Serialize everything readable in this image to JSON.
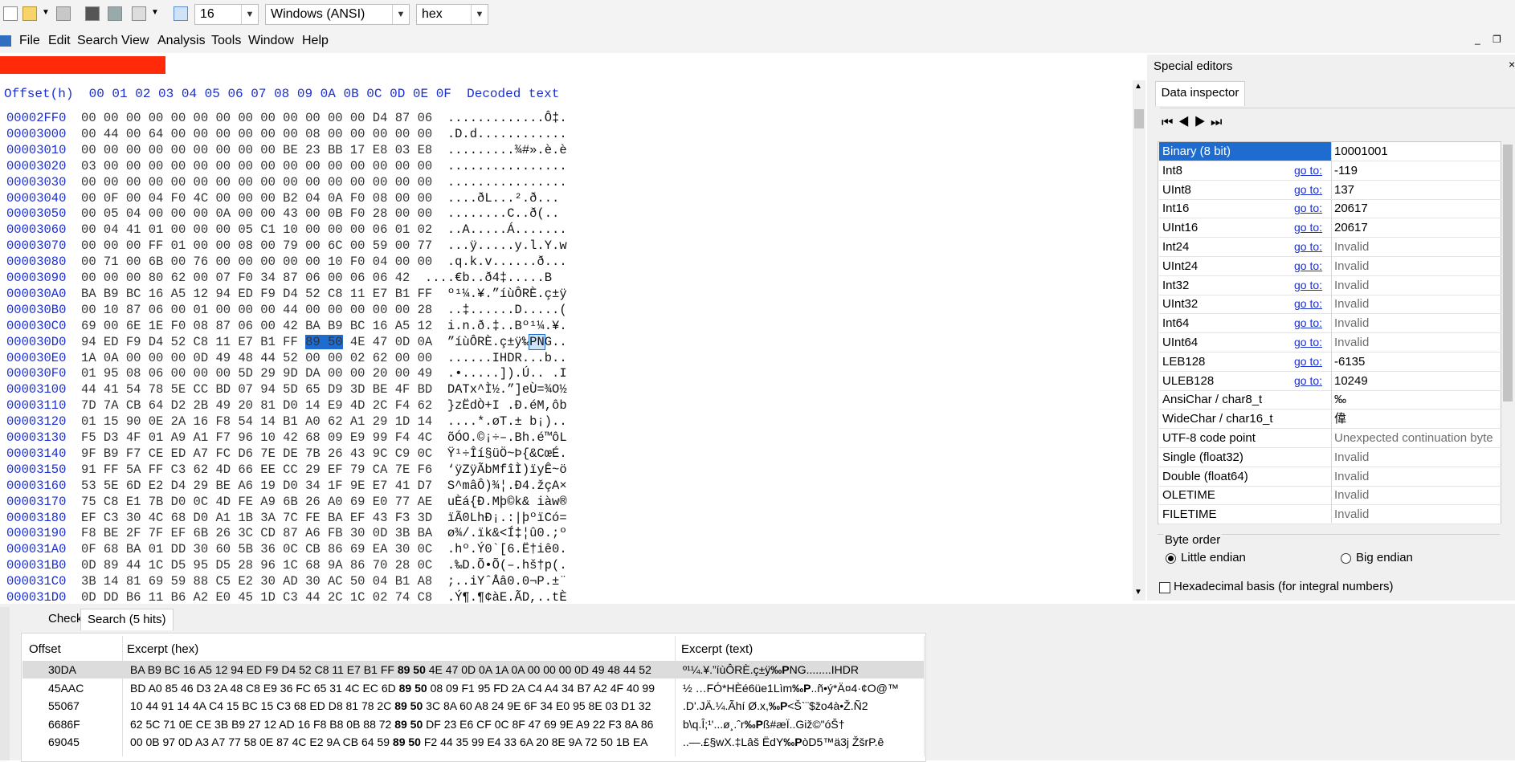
{
  "toolbar": {
    "bytes_per_row": "16",
    "encoding": "Windows (ANSI)",
    "number_format": "hex"
  },
  "menu": [
    "File",
    "Edit",
    "Search",
    "View",
    "Analysis",
    "Tools",
    "Window",
    "Help"
  ],
  "hex": {
    "offset_header": "Offset(h)",
    "columns": "00 01 02 03 04 05 06 07 08 09 0A 0B 0C 0D 0E 0F",
    "decoded_header": "Decoded text",
    "rows": [
      {
        "off": "00002FF0",
        "hex": "00 00 00 00 00 00 00 00 00 00 00 00 00 D4 87 06",
        "text": ".............Ô‡."
      },
      {
        "off": "00003000",
        "hex": "00 44 00 64 00 00 00 00 00 00 08 00 00 00 00 00",
        "text": ".D.d............"
      },
      {
        "off": "00003010",
        "hex": "00 00 00 00 00 00 00 00 00 BE 23 BB 17 E8 03 E8",
        "text": ".........¾#».è.è"
      },
      {
        "off": "00003020",
        "hex": "03 00 00 00 00 00 00 00 00 00 00 00 00 00 00 00",
        "text": "................"
      },
      {
        "off": "00003030",
        "hex": "00 00 00 00 00 00 00 00 00 00 00 00 00 00 00 00",
        "text": "................"
      },
      {
        "off": "00003040",
        "hex": "00 0F 00 04 F0 4C 00 00 00 B2 04 0A F0 08 00 00",
        "text": "....ðL...².ð..."
      },
      {
        "off": "00003050",
        "hex": "00 05 04 00 00 00 0A 00 00 43 00 0B F0 28 00 00",
        "text": "........C..ð(.."
      },
      {
        "off": "00003060",
        "hex": "00 04 41 01 00 00 00 05 C1 10 00 00 00 06 01 02",
        "text": "..A.....Á......."
      },
      {
        "off": "00003070",
        "hex": "00 00 00 FF 01 00 00 08 00 79 00 6C 00 59 00 77",
        "text": "...ÿ.....y.l.Y.w"
      },
      {
        "off": "00003080",
        "hex": "00 71 00 6B 00 76 00 00 00 00 00 10 F0 04 00 00",
        "text": ".q.k.v......ð..."
      },
      {
        "off": "00003090",
        "hex": "00 00 00 80 62 00 07 F0 34 87 06 00 06 06 42",
        "text": "....€b..ð4‡.....B"
      },
      {
        "off": "000030A0",
        "hex": "BA B9 BC 16 A5 12 94 ED F9 D4 52 C8 11 E7 B1 FF",
        "text": "º¹¼.¥.”íùÔRÈ.ç±ÿ"
      },
      {
        "off": "000030B0",
        "hex": "00 10 87 06 00 01 00 00 00 44 00 00 00 00 00 28",
        "text": "..‡......D.....("
      },
      {
        "off": "000030C0",
        "hex": "69 00 6E 1E F0 08 87 06 00 42 BA B9 BC 16 A5 12",
        "text": "i.n.ð.‡..Bº¹¼.¥."
      },
      {
        "off": "000030D0",
        "hex": "94 ED F9 D4 52 C8 11 E7 B1 FF 89 50 4E 47 0D 0A",
        "text": "”íùÔRÈ.ç±ÿ‰PNG.."
      },
      {
        "off": "000030E0",
        "hex": "1A 0A 00 00 00 0D 49 48 44 52 00 00 02 62 00 00",
        "text": "......IHDR...b.."
      },
      {
        "off": "000030F0",
        "hex": "01 95 08 06 00 00 00 5D 29 9D DA 00 00 20 00 49",
        "text": ".•.....]).Ú.. .I"
      },
      {
        "off": "00003100",
        "hex": "44 41 54 78 5E CC BD 07 94 5D 65 D9 3D BE 4F BD",
        "text": "DATx^Ì½.”]eÙ=¾O½"
      },
      {
        "off": "00003110",
        "hex": "7D 7A CB 64 D2 2B 49 20 81 D0 14 E9 4D 2C F4 62",
        "text": "}zËdÒ+I .Ð.éM,ôb"
      },
      {
        "off": "00003120",
        "hex": "01 15 90 0E 2A 16 F8 54 14 B1 A0 62 A1 29 1D 14",
        "text": "....*.øT.± b¡).."
      },
      {
        "off": "00003130",
        "hex": "F5 D3 4F 01 A9 A1 F7 96 10 42 68 09 E9 99 F4 4C",
        "text": "õÓO.©¡÷–.Bh.é™ôL"
      },
      {
        "off": "00003140",
        "hex": "9F B9 F7 CE ED A7 FC D6 7E DE 7B 26 43 9C C9 0C",
        "text": "Ÿ¹÷Îí§üÖ~Þ{&CœÉ."
      },
      {
        "off": "00003150",
        "hex": "91 FF 5A FF C3 62 4D 66 EE CC 29 EF 79 CA 7E F6",
        "text": "‘ÿZÿÃbMfîÌ)ïyÊ~ö"
      },
      {
        "off": "00003160",
        "hex": "53 5E 6D E2 D4 29 BE A6 19 D0 34 1F 9E E7 41 D7",
        "text": "S^mâÔ)¾¦.Ð4.žçA×"
      },
      {
        "off": "00003170",
        "hex": "75 C8 E1 7B D0 0C 4D FE A9 6B 26 A0 69 E0 77 AE",
        "text": "uÈá{Ð.Mþ©k& iàw®"
      },
      {
        "off": "00003180",
        "hex": "EF C3 30 4C 68 D0 A1 1B 3A 7C FE BA EF 43 F3 3D",
        "text": "ïÃ0LhÐ¡.:|þºïCó="
      },
      {
        "off": "00003190",
        "hex": "F8 BE 2F 7F EF 6B 26 3C CD 87 A6 FB 30 0D 3B BA",
        "text": "ø¾/.ïk&<Í‡¦û0.;º"
      },
      {
        "off": "000031A0",
        "hex": "0F 68 BA 01 DD 30 60 5B 36 0C CB 86 69 EA 30 0C",
        "text": ".hº.Ý0`[6.Ë†iê0."
      },
      {
        "off": "000031B0",
        "hex": "0D 89 44 1C D5 95 D5 28 96 1C 68 9A 86 70 28 0C",
        "text": ".‰D.Õ•Õ(–.hš†p(."
      },
      {
        "off": "000031C0",
        "hex": "3B 14 81 69 59 88 C5 E2 30 AD 30 AC 50 04 B1 A8",
        "text": ";..iYˆÅâ0.0¬P.±¨"
      },
      {
        "off": "000031D0",
        "hex": "0D DD B6 11 B6 A2 E0 45 1D C3 44 2C 1C 02 74 C8",
        "text": ".Ý¶.¶¢àE.ÃD,..tÈ"
      }
    ]
  },
  "special_editors": {
    "title": "Special editors",
    "tab": "Data inspector",
    "goto_label": "go to:",
    "rows": [
      {
        "name": "Binary (8 bit)",
        "value": "10001001",
        "goto": false,
        "invalid": false
      },
      {
        "name": "Int8",
        "value": "-119",
        "goto": true,
        "invalid": false
      },
      {
        "name": "UInt8",
        "value": "137",
        "goto": true,
        "invalid": false
      },
      {
        "name": "Int16",
        "value": "20617",
        "goto": true,
        "invalid": false
      },
      {
        "name": "UInt16",
        "value": "20617",
        "goto": true,
        "invalid": false
      },
      {
        "name": "Int24",
        "value": "Invalid",
        "goto": true,
        "invalid": true
      },
      {
        "name": "UInt24",
        "value": "Invalid",
        "goto": true,
        "invalid": true
      },
      {
        "name": "Int32",
        "value": "Invalid",
        "goto": true,
        "invalid": true
      },
      {
        "name": "UInt32",
        "value": "Invalid",
        "goto": true,
        "invalid": true
      },
      {
        "name": "Int64",
        "value": "Invalid",
        "goto": true,
        "invalid": true
      },
      {
        "name": "UInt64",
        "value": "Invalid",
        "goto": true,
        "invalid": true
      },
      {
        "name": "LEB128",
        "value": "-6135",
        "goto": true,
        "invalid": false
      },
      {
        "name": "ULEB128",
        "value": "10249",
        "goto": true,
        "invalid": false
      },
      {
        "name": "AnsiChar / char8_t",
        "value": "‰",
        "goto": false,
        "invalid": false
      },
      {
        "name": "WideChar / char16_t",
        "value": "偉",
        "goto": false,
        "invalid": false
      },
      {
        "name": "UTF-8 code point",
        "value": "Unexpected continuation byte",
        "goto": false,
        "invalid": true
      },
      {
        "name": "Single (float32)",
        "value": "Invalid",
        "goto": false,
        "invalid": true
      },
      {
        "name": "Double (float64)",
        "value": "Invalid",
        "goto": false,
        "invalid": true
      },
      {
        "name": "OLETIME",
        "value": "Invalid",
        "goto": false,
        "invalid": true
      },
      {
        "name": "FILETIME",
        "value": "Invalid",
        "goto": false,
        "invalid": true
      }
    ],
    "byte_order_label": "Byte order",
    "little_endian": "Little endian",
    "big_endian": "Big endian",
    "hex_basis": "Hexadecimal basis (for integral numbers)"
  },
  "results": {
    "tab_checksum": "Checksum",
    "tab_search": "Search (5 hits)",
    "col_offset": "Offset",
    "col_hex": "Excerpt (hex)",
    "col_text": "Excerpt (text)",
    "rows": [
      {
        "offset": "30DA",
        "pre": "BA B9 BC 16 A5 12 94 ED F9 D4 52 C8 11 E7 B1 FF ",
        "match": "89 50",
        "post": " 4E 47 0D 0A 1A 0A 00 00 00 0D 49 48 44 52",
        "tpre": "º¹¼.¥.”íùÔRÈ.ç±ÿ",
        "tmatch": "‰P",
        "tpost": "NG........IHDR"
      },
      {
        "offset": "45AAC",
        "pre": "BD A0 85 46 D3 2A 48 C8 E9 36 FC 65 31 4C EC 6D ",
        "match": "89 50",
        "post": " 08 09 F1 95 FD 2A C4 A4 34 B7 A2 4F 40 99",
        "tpre": "½ …FÓ*HÈé6üe1Lìm",
        "tmatch": "‰P",
        "tpost": "..ñ•ý*Ä¤4·¢O@™"
      },
      {
        "offset": "55067",
        "pre": "10 44 91 14 4A C4 15 BC 15 C3 68 ED D8 81 78 2C ",
        "match": "89 50",
        "post": " 3C 8A 60 A8 24 9E 6F 34 E0 95 8E 03 D1 32",
        "tpre": ".D'.JÄ.¼.Ãhí Ø.x,",
        "tmatch": "‰P",
        "tpost": "<Š`¨$žo4à•Ž.Ñ2"
      },
      {
        "offset": "6686F",
        "pre": "62 5C 71 0E CE 3B B9 27 12 AD 16 F8 B8 0B 88 72 ",
        "match": "89 50",
        "post": " DF 23 E6 CF 0C 8F 47 69 9E A9 22 F3 8A 86",
        "tpre": "b\\q.Î;¹'...ø¸.ˆr",
        "tmatch": "‰P",
        "tpost": "ß#æÏ..Giž©\"óŠ†"
      },
      {
        "offset": "69045",
        "pre": "00 0B 97 0D A3 A7 77 58 0E 87 4C E2 9A CB 64 59 ",
        "match": "89 50",
        "post": " F2 44 35 99 E4 33 6A 20 8E 9A 72 50 1B EA",
        "tpre": "..—.£§wX.‡Lâš ËdY",
        "tmatch": "‰P",
        "tpost": "òD5™ä3j ŽšrP.ê"
      }
    ]
  }
}
